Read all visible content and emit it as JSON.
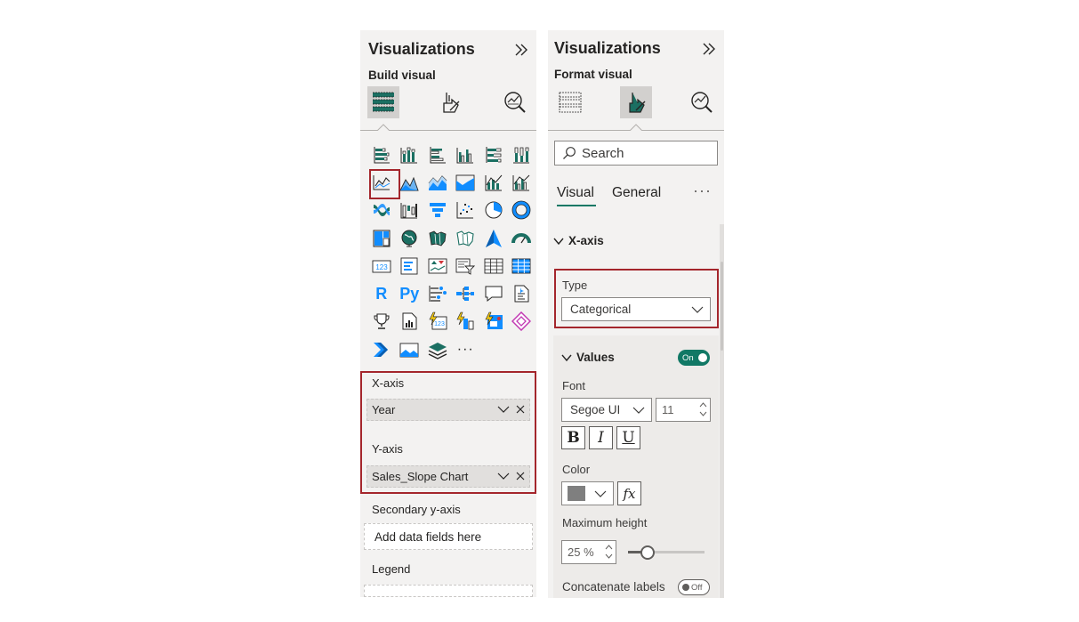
{
  "left": {
    "title": "Visualizations",
    "subtitle": "Build visual",
    "more_label": "···",
    "wells": {
      "x_axis": {
        "label": "X-axis",
        "field": "Year"
      },
      "y_axis": {
        "label": "Y-axis",
        "field": "Sales_Slope Chart"
      },
      "secondary_y": {
        "label": "Secondary y-axis",
        "placeholder": "Add data fields here"
      },
      "legend": {
        "label": "Legend"
      }
    },
    "py_label": "Py",
    "r_label": "R",
    "kpi_label": "123"
  },
  "right": {
    "title": "Visualizations",
    "subtitle": "Format visual",
    "search_placeholder": "Search",
    "tabs": [
      "Visual",
      "General"
    ],
    "more_label": "···",
    "xaxis_section": "X-axis",
    "type_label": "Type",
    "type_value": "Categorical",
    "values_section": "Values",
    "values_toggle": "On",
    "font_label": "Font",
    "font_family": "Segoe UI",
    "font_size": "11",
    "bold": "B",
    "italic": "I",
    "underline": "U",
    "color_label": "Color",
    "color_swatch": "#7f7f7f",
    "fx_label": "fx",
    "max_height_label": "Maximum height",
    "max_height_value": "25 %",
    "max_height_percent": 25,
    "concat_label": "Concatenate labels",
    "concat_toggle": "Off"
  },
  "colors": {
    "accent": "#117865",
    "highlight_red": "#a4262c",
    "icon_teal": "#1b6f62",
    "icon_blue": "#118dff",
    "icon_dark": "#252423"
  }
}
